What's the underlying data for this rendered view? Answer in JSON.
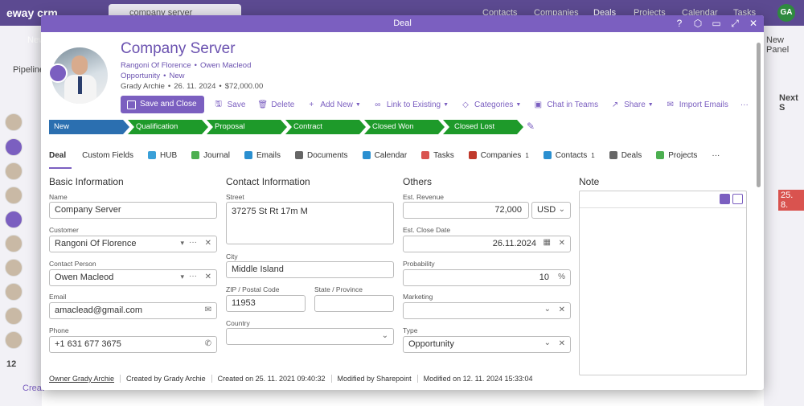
{
  "background": {
    "logo": "eway crm",
    "search_text": "company server",
    "nav": [
      "Contacts",
      "Companies",
      "Deals",
      "Projects",
      "Calendar",
      "Tasks"
    ],
    "avatar": "GA",
    "new_button": "New",
    "pipelines_label": "Pipeline",
    "new_panel": "New Panel",
    "next_label": "Next S",
    "date_badge": "25. 8.",
    "count": "12",
    "create_label": "Creat"
  },
  "modal": {
    "title": "Deal",
    "header": {
      "deal_name": "Company Server",
      "customer": "Rangoni Of Florence",
      "contact": "Owen Macleod",
      "type": "Opportunity",
      "stage": "New",
      "owner": "Grady Archie",
      "close_date": "26. 11. 2024",
      "revenue": "$72,000.00"
    },
    "toolbar": {
      "save_close": "Save and Close",
      "save": "Save",
      "delete": "Delete",
      "add_new": "Add New",
      "link_existing": "Link to Existing",
      "categories": "Categories",
      "chat_teams": "Chat in Teams",
      "share": "Share",
      "import_emails": "Import Emails",
      "more": "···"
    },
    "pipeline": [
      {
        "label": "New",
        "color": "#2b6fb0"
      },
      {
        "label": "Qualification",
        "color": "#1e9a2a"
      },
      {
        "label": "Proposal",
        "color": "#1e9a2a"
      },
      {
        "label": "Contract",
        "color": "#1e9a2a"
      },
      {
        "label": "Closed Won",
        "color": "#1e9a2a"
      },
      {
        "label": "Closed Lost",
        "color": "#1e9a2a"
      }
    ],
    "tabs": [
      {
        "label": "Deal"
      },
      {
        "label": "Custom Fields"
      },
      {
        "label": "HUB"
      },
      {
        "label": "Journal"
      },
      {
        "label": "Emails"
      },
      {
        "label": "Documents"
      },
      {
        "label": "Calendar"
      },
      {
        "label": "Tasks"
      },
      {
        "label": "Companies",
        "count": "1"
      },
      {
        "label": "Contacts",
        "count": "1"
      },
      {
        "label": "Deals"
      },
      {
        "label": "Projects"
      },
      {
        "label": "···"
      }
    ],
    "basic": {
      "title": "Basic Information",
      "name_label": "Name",
      "name_value": "Company Server",
      "customer_label": "Customer",
      "customer_value": "Rangoni Of Florence",
      "contact_label": "Contact Person",
      "contact_value": "Owen Macleod",
      "email_label": "Email",
      "email_value": "amaclead@gmail.com",
      "phone_label": "Phone",
      "phone_value": "+1 631 677 3675"
    },
    "contact_info": {
      "title": "Contact Information",
      "street_label": "Street",
      "street_value": "37275 St  Rt 17m M",
      "city_label": "City",
      "city_value": "Middle Island",
      "zip_label": "ZIP / Postal Code",
      "zip_value": "11953",
      "state_label": "State / Province",
      "state_value": "",
      "country_label": "Country",
      "country_value": ""
    },
    "others": {
      "title": "Others",
      "revenue_label": "Est. Revenue",
      "revenue_value": "72,000",
      "currency": "USD",
      "close_label": "Est. Close Date",
      "close_value": "26.11.2024",
      "prob_label": "Probability",
      "prob_value": "10",
      "prob_unit": "%",
      "marketing_label": "Marketing",
      "marketing_value": "",
      "type_label": "Type",
      "type_value": "Opportunity"
    },
    "note": {
      "title": "Note"
    },
    "footer": {
      "owner": "Owner Grady Archie",
      "created_by": "Created by Grady Archie",
      "created_on": "Created on 25. 11. 2021 09:40:32",
      "modified_by": "Modified by Sharepoint",
      "modified_on": "Modified on 12. 11. 2024 15:33:04"
    }
  }
}
